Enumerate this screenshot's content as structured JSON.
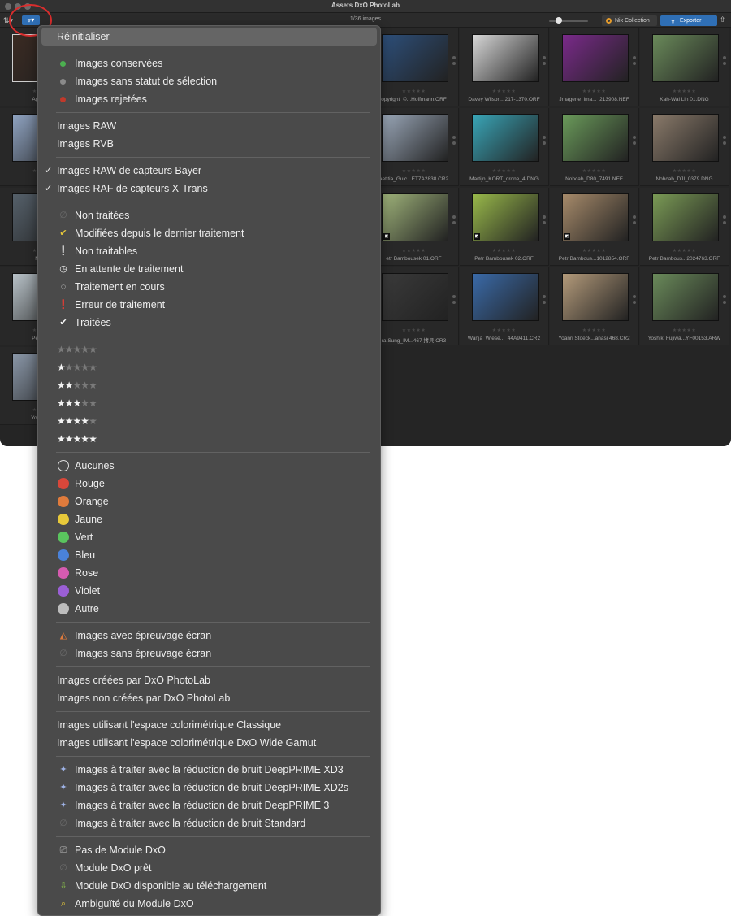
{
  "window": {
    "title": "Assets DxO PhotoLab"
  },
  "toolbar": {
    "sort_icon": "sort-icon",
    "filter_icon": "filter-icon",
    "image_count": "1/36 images",
    "nik_label": "Nik Collection",
    "export_label": "Exporter",
    "share_icon": "share-icon"
  },
  "grid": {
    "rows": [
      [
        "Agathe Po",
        "",
        "",
        "",
        "opyright_©...Hoffmann.ORF",
        "Davey Wilson...217-1370.ORF",
        "Jmagerie_ima..._213908.NEF",
        "Kah-Wai Lin 01.DNG"
      ],
      [
        "Kah-W",
        "",
        "",
        "",
        "aetitia_Guic...ET7A2838.CR2",
        "Martijn_KORT_drone_4.DNG",
        "Nohcab_D80_7491.NEF",
        "Nohcab_DJI_0379.DNG"
      ],
      [
        "Nohcab",
        "",
        "",
        "",
        "etr Bambousek 01.ORF",
        "Petr Bambousek 02.ORF",
        "Petr Bambous...1012854.ORF",
        "Petr Bambous...2024763.ORF"
      ],
      [
        "Petr Bamb",
        "",
        "",
        "",
        "ra Sung_IM...467 拷貝.CR3",
        "Wanja_Wiese..._44A9411.CR2",
        "Yoanri Stoeck...anasi 468.CR2",
        "Yoshiki Fujiwa...YF00153.ARW"
      ],
      [
        "Yoshiki Fuji"
      ]
    ],
    "stars_text": "★★★★★"
  },
  "menu": {
    "reset": "Réinitialiser",
    "selection": [
      {
        "label": "Images conservées",
        "color": "#4caf50"
      },
      {
        "label": "Images sans statut de sélection",
        "color": "#8a8a8a"
      },
      {
        "label": "Images rejetées",
        "color": "#c0392b"
      }
    ],
    "raw_rvb": [
      "Images RAW",
      "Images RVB"
    ],
    "sensor": [
      {
        "label": "Images RAW de capteurs Bayer",
        "checked": true
      },
      {
        "label": "Images RAF de capteurs X-Trans",
        "checked": true
      }
    ],
    "processing": [
      {
        "label": "Non traitées",
        "icon": "not-processed-icon"
      },
      {
        "label": "Modifiées depuis le dernier traitement",
        "icon": "modified-check-icon"
      },
      {
        "label": "Non traitables",
        "icon": "exclamation-icon"
      },
      {
        "label": "En attente de traitement",
        "icon": "clock-icon"
      },
      {
        "label": "Traitement en cours",
        "icon": "spinner-icon"
      },
      {
        "label": "Erreur de traitement",
        "icon": "error-exclamation-icon"
      },
      {
        "label": "Traitées",
        "icon": "check-icon"
      }
    ],
    "ratings": [
      0,
      1,
      2,
      3,
      4,
      5
    ],
    "colors": [
      {
        "label": "Aucunes",
        "color": "none"
      },
      {
        "label": "Rouge",
        "color": "#d9473a"
      },
      {
        "label": "Orange",
        "color": "#e07b3c"
      },
      {
        "label": "Jaune",
        "color": "#e8c93a"
      },
      {
        "label": "Vert",
        "color": "#5ac45e"
      },
      {
        "label": "Bleu",
        "color": "#4a82d9"
      },
      {
        "label": "Rose",
        "color": "#d65bb0"
      },
      {
        "label": "Violet",
        "color": "#9b5fd6"
      },
      {
        "label": "Autre",
        "color": "#bdbdbd"
      }
    ],
    "proofing": [
      {
        "label": "Images avec épreuvage écran",
        "icon": "softproof-icon"
      },
      {
        "label": "Images sans épreuvage écran",
        "icon": "no-softproof-icon"
      }
    ],
    "created": [
      "Images créées par DxO PhotoLab",
      "Images non créées par DxO PhotoLab"
    ],
    "colorspace": [
      "Images utilisant l'espace colorimétrique Classique",
      "Images utilisant l'espace colorimétrique DxO Wide Gamut"
    ],
    "denoise": [
      {
        "label": "Images à traiter avec la réduction de bruit DeepPRIME XD3",
        "icon": "sparkle-icon"
      },
      {
        "label": "Images à traiter avec la réduction de bruit DeepPRIME XD2s",
        "icon": "sparkle-icon"
      },
      {
        "label": "Images à traiter avec la réduction de bruit DeepPRIME 3",
        "icon": "sparkle-icon"
      },
      {
        "label": "Images à traiter avec la réduction de bruit Standard",
        "icon": "no-denoise-icon"
      }
    ],
    "module": [
      {
        "label": "Pas de Module DxO",
        "icon": "camera-icon"
      },
      {
        "label": "Module DxO prêt",
        "icon": "module-ready-icon"
      },
      {
        "label": "Module DxO disponible au téléchargement",
        "icon": "download-icon"
      },
      {
        "label": "Ambiguïté du Module DxO",
        "icon": "ambiguous-module-icon"
      }
    ]
  }
}
